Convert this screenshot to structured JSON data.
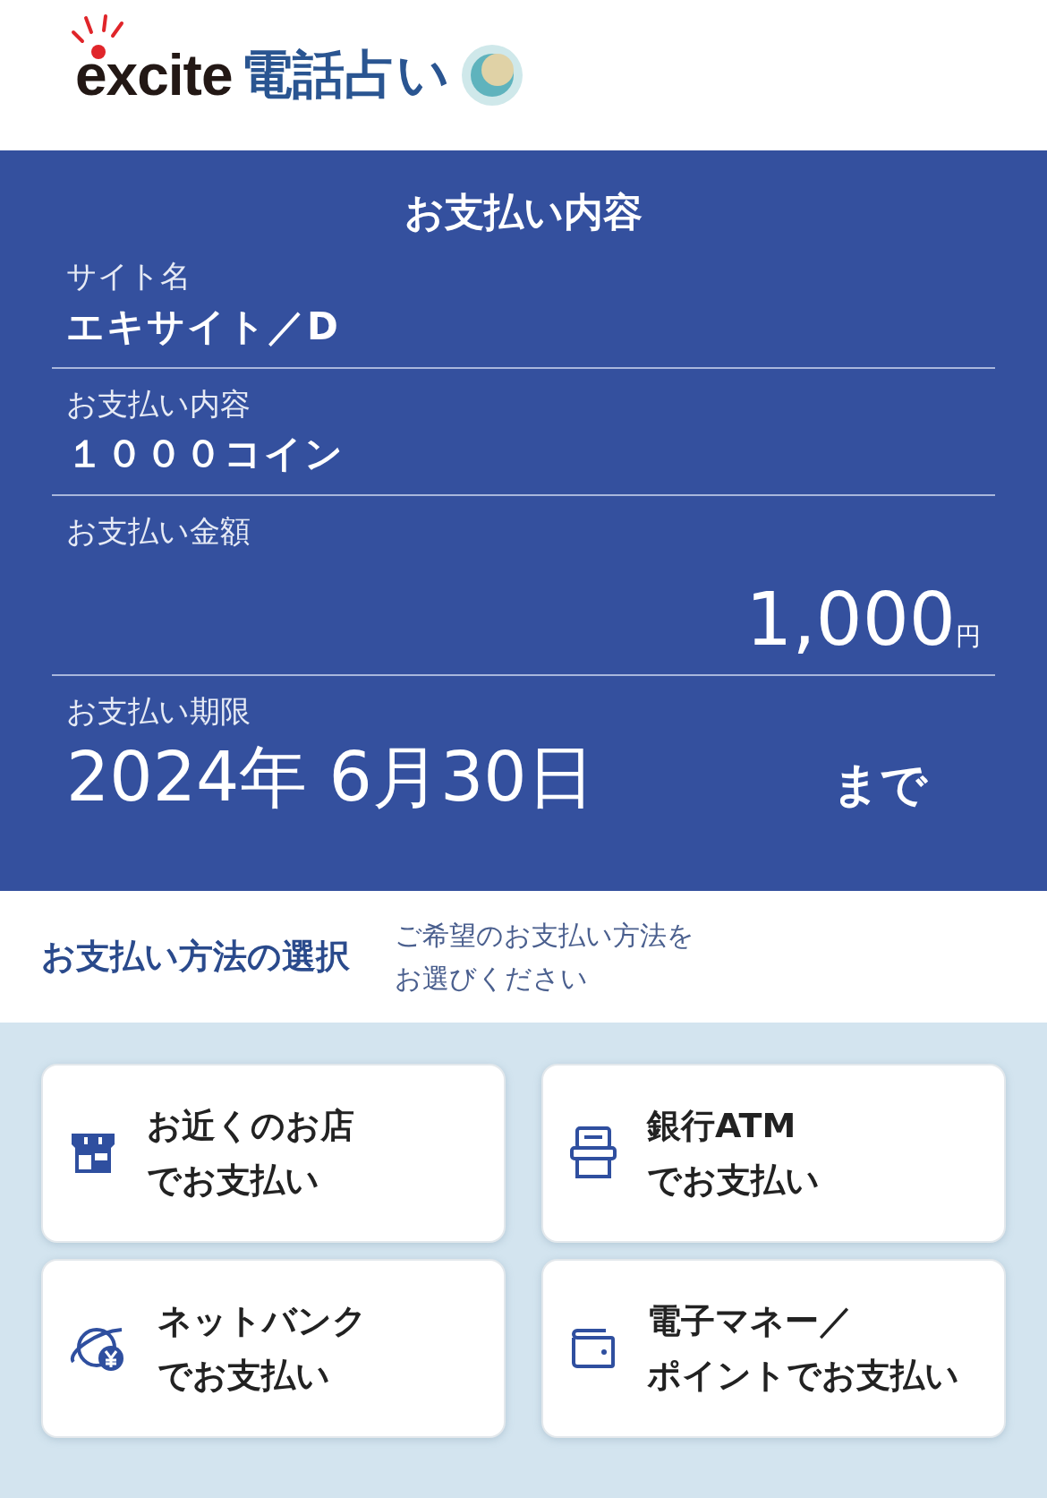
{
  "logo": {
    "brand": "excite",
    "service": "電話占い"
  },
  "summary": {
    "title": "お支払い内容",
    "fields": [
      {
        "kind": "text",
        "label": "サイト名",
        "value": "エキサイト／D"
      },
      {
        "kind": "text",
        "label": "お支払い内容",
        "value": "１０００コイン"
      },
      {
        "kind": "amount",
        "label": "お支払い金額",
        "value": "1,000",
        "unit": "円"
      },
      {
        "kind": "deadline",
        "label": "お支払い期限",
        "value": "2024年 6月30日",
        "suffix": "まで"
      }
    ]
  },
  "method": {
    "heading": "お支払い方法の選択",
    "hint": [
      "ご希望のお支払い方法を",
      "お選びください"
    ]
  },
  "options": [
    {
      "kind": "store",
      "lines": [
        "お近くのお店",
        "でお支払い"
      ]
    },
    {
      "kind": "atm",
      "lines": [
        "銀行ATM",
        "でお支払い"
      ]
    },
    {
      "kind": "netbank",
      "lines": [
        "ネットバンク",
        "でお支払い"
      ]
    },
    {
      "kind": "wallet",
      "lines": [
        "電子マネー／",
        "ポイントでお支払い"
      ]
    }
  ]
}
